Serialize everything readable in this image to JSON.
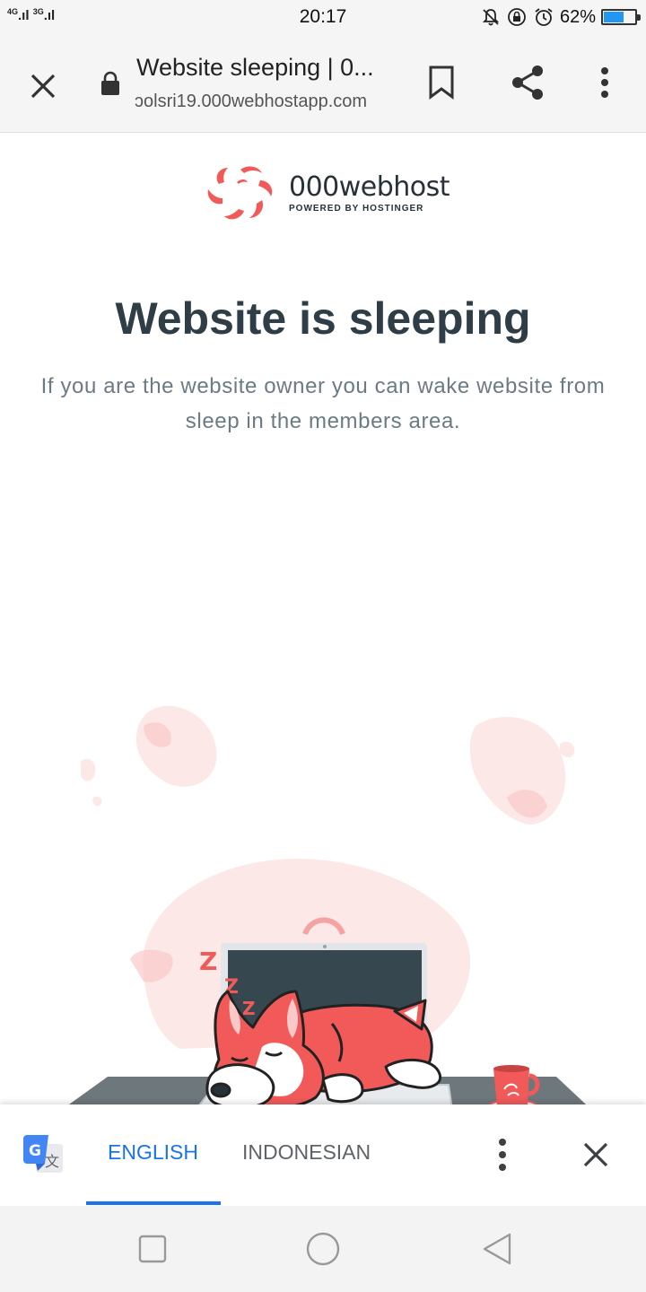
{
  "status_bar": {
    "network_1": "4G",
    "network_2": "3G",
    "time": "20:17",
    "battery_text": "62%",
    "battery_level": 0.62,
    "icons": [
      "mute-icon",
      "rotation-lock-icon",
      "alarm-icon",
      "battery-icon"
    ]
  },
  "toolbar": {
    "title": "Website sleeping | 0...",
    "url": "ɔolsri19.000webhostapp.com",
    "icons": [
      "close-icon",
      "lock-icon",
      "bookmark-icon",
      "share-icon",
      "more-vert-icon"
    ]
  },
  "page": {
    "logo_name": "000webhost",
    "logo_sub": "POWERED BY HOSTINGER",
    "headline": "Website is sleeping",
    "subtext": "If you are the website owner you can wake website from sleep in the members area.",
    "illustration_text": "Z",
    "colors": {
      "brand": "#f25a5a",
      "heading": "#2f3d46",
      "body": "#6b7b83",
      "desk": "#6d777c",
      "screen": "#37474f"
    }
  },
  "translate_bar": {
    "tab_active": "ENGLISH",
    "tab_inactive": "INDONESIAN",
    "accent": "#1a73e8",
    "icons": [
      "google-translate-icon",
      "more-vert-icon",
      "close-icon"
    ]
  },
  "nav_bar": {
    "icons": [
      "recents-icon",
      "home-icon",
      "back-icon"
    ]
  }
}
